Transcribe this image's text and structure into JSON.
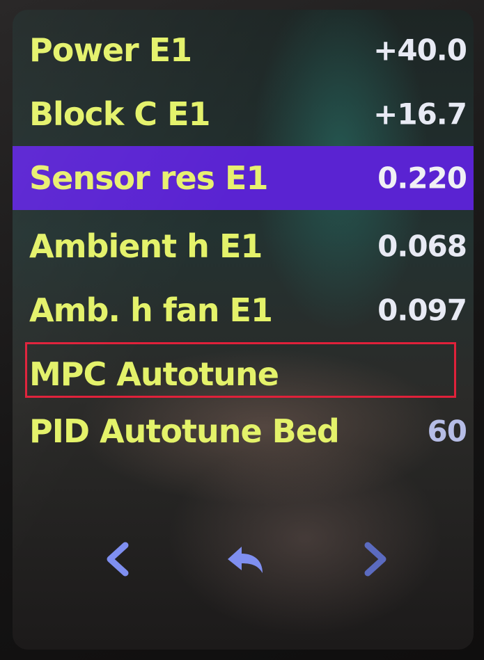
{
  "menu": {
    "items": [
      {
        "label": "Power E1",
        "value": "+40.0"
      },
      {
        "label": "Block C E1",
        "value": "+16.7"
      },
      {
        "label": "Sensor res E1",
        "value": "0.220",
        "selected": true
      },
      {
        "label": "Ambient h E1",
        "value": "0.068"
      },
      {
        "label": "Amb. h fan E1",
        "value": "0.097"
      },
      {
        "label": "MPC Autotune",
        "value": ""
      },
      {
        "label": "PID Autotune Bed",
        "value": "60"
      }
    ]
  },
  "nav": {
    "prev_icon": "chevron-left-icon",
    "back_icon": "back-arrow-icon",
    "next_icon": "chevron-right-icon"
  },
  "colors": {
    "label": "#e4f26a",
    "value": "#e8eaf4",
    "selected_bg": "#5a23d2",
    "nav_icon": "#7f8ff0",
    "highlight_box": "#e0213a"
  }
}
